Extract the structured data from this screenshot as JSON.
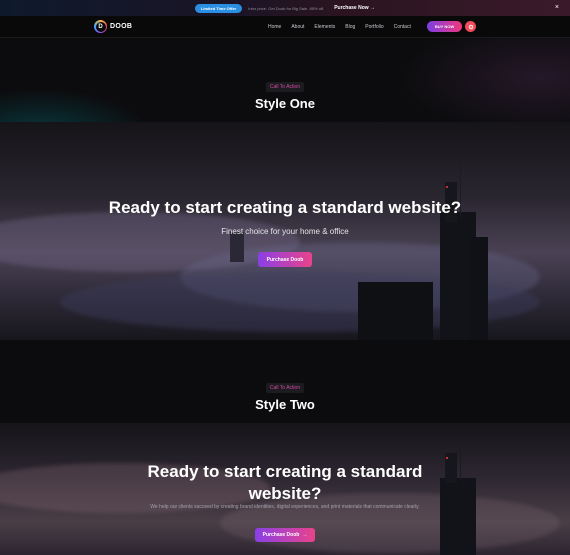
{
  "topbar": {
    "badge": "Limited Time Offer",
    "text": "Intro price. Get Doob for Big Sale -95% off.",
    "link": "Purchase Now",
    "link_arrow": "→",
    "close_icon": "×"
  },
  "header": {
    "logo_letter": "D",
    "logo_text": "DOOB",
    "nav": [
      "Home",
      "About",
      "Elements",
      "Blog",
      "Portfolio",
      "Contact"
    ],
    "buy_label": "BUY NOW",
    "settings_icon": "gear-icon"
  },
  "section_one": {
    "pill": "Call To Action",
    "title": "Style One"
  },
  "banner_one": {
    "title": "Ready to start creating a standard website?",
    "subtitle": "Finest choice for your home & office",
    "button": "Purchase Doob"
  },
  "section_two": {
    "pill": "Call To Action",
    "title": "Style Two"
  },
  "banner_two": {
    "title_line1": "Ready to start creating a standard",
    "title_line2": "website?",
    "subtitle": "We help our clients succeed by creating brand identities, digital experiences, and print materials that communicate clearly.",
    "button": "Purchase Doob",
    "button_arrow": "→"
  },
  "colors": {
    "accent_gradient_start": "#8a3fe6",
    "accent_gradient_end": "#e9438b",
    "badge_blue": "#2a8fe3",
    "pill_pink": "#d24a9f",
    "gear_red": "#f04c59"
  }
}
